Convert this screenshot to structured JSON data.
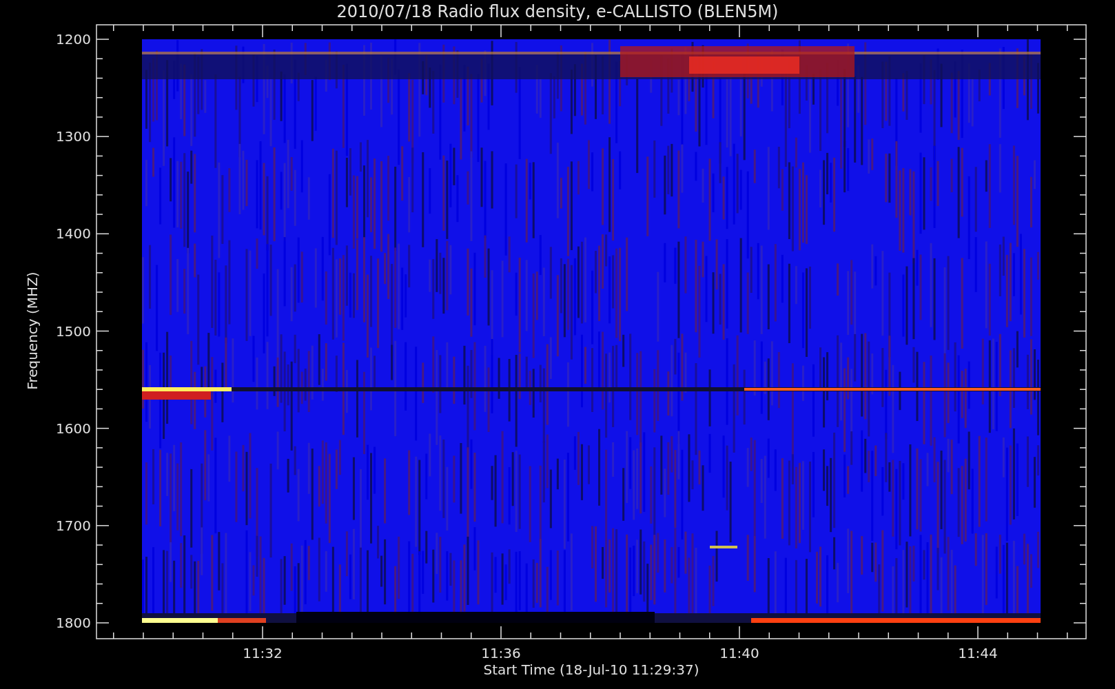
{
  "title": "2010/07/18  Radio flux density, e-CALLISTO (BLEN5M)",
  "ylabel": "Frequency (MHZ)",
  "yticks": [
    "1200",
    "1300",
    "1400",
    "1500",
    "1600",
    "1700",
    "1800"
  ],
  "xticks": [
    "11:32",
    "11:36",
    "11:40",
    "11:44"
  ],
  "xlabel": "Start Time (18-Jul-10 11:29:37)"
}
